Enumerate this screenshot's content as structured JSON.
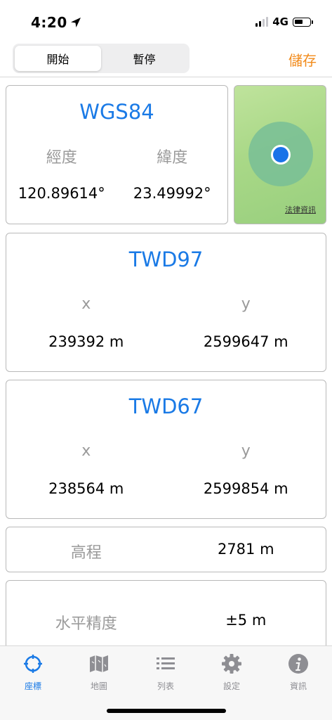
{
  "status_bar": {
    "time": "4:20",
    "network": "4G"
  },
  "toolbar": {
    "segments": [
      "開始",
      "暫停"
    ],
    "active_segment": 0,
    "save_label": "儲存"
  },
  "wgs84": {
    "title": "WGS84",
    "col1_label": "經度",
    "col2_label": "緯度",
    "col1_value": "120.89614°",
    "col2_value": "23.49992°"
  },
  "map": {
    "legal_link": "法律資訊"
  },
  "twd97": {
    "title": "TWD97",
    "col1_label": "x",
    "col2_label": "y",
    "col1_value": "239392 m",
    "col2_value": "2599647 m"
  },
  "twd67": {
    "title": "TWD67",
    "col1_label": "x",
    "col2_label": "y",
    "col1_value": "238564 m",
    "col2_value": "2599854 m"
  },
  "elevation": {
    "label": "高程",
    "value": "2781 m"
  },
  "accuracy": {
    "label": "水平精度",
    "value": "±5 m"
  },
  "tabbar": {
    "tabs": [
      {
        "label": "座標",
        "icon": "crosshair-icon"
      },
      {
        "label": "地圖",
        "icon": "map-icon"
      },
      {
        "label": "列表",
        "icon": "list-icon"
      },
      {
        "label": "設定",
        "icon": "gear-icon"
      },
      {
        "label": "資訊",
        "icon": "info-icon"
      }
    ],
    "active_tab": 0
  },
  "colors": {
    "accent": "#1a7ae6",
    "save": "#f28b1b",
    "map_green": "#a9d887",
    "location_dot": "#1a73e8"
  }
}
